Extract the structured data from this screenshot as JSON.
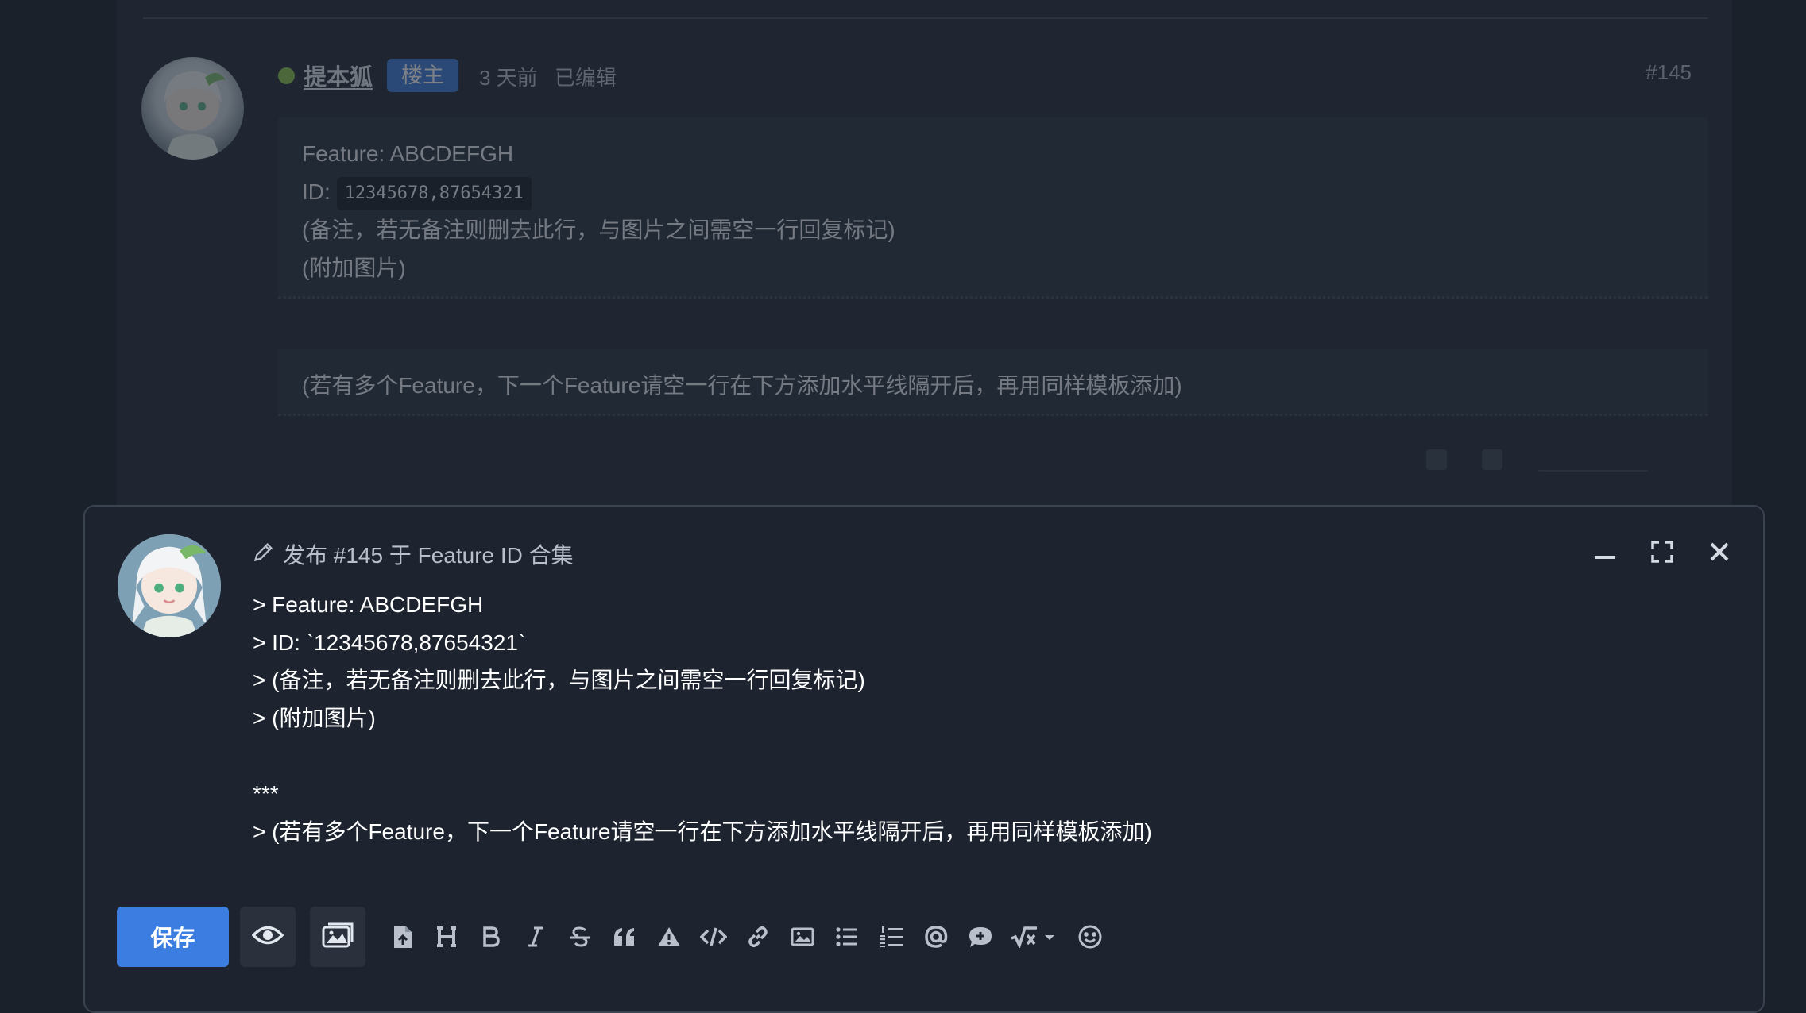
{
  "thread": {
    "post": {
      "author": "提本狐",
      "badge": "楼主",
      "time": "3 天前",
      "edited": "已编辑",
      "number": "#145",
      "quote_lines": [
        "Feature: ABCDEFGH",
        "ID:",
        "(备注，若无备注则删去此行，与图片之间需空一行回复标记)",
        "(附加图片)"
      ],
      "id_code": "12345678,87654321",
      "second_quote": "(若有多个Feature，下一个Feature请空一行在下方添加水平线隔开后，再用同样模板添加)"
    }
  },
  "composer": {
    "title": "发布 #145 于 Feature ID 合集",
    "lines": [
      "> Feature: ABCDEFGH",
      "> ID: `12345678,87654321`",
      "> (备注，若无备注则删去此行，与图片之间需空一行回复标记)",
      "> (附加图片)",
      "",
      "***",
      "> (若有多个Feature，下一个Feature请空一行在下方添加水平线隔开后，再用同样模板添加)"
    ],
    "save_label": "保存",
    "toolbar_icons": [
      "upload-file-icon",
      "heading-icon",
      "bold-icon",
      "italic-icon",
      "strikethrough-icon",
      "quote-icon",
      "warning-icon",
      "code-icon",
      "link-icon",
      "image-icon",
      "bulleted-list-icon",
      "numbered-list-icon",
      "mention-icon",
      "reply-bubble-icon",
      "math-icon",
      "emoji-icon"
    ]
  },
  "colors": {
    "accent": "#3b7de0",
    "online": "#8bc34a",
    "background": "#1b212b"
  }
}
